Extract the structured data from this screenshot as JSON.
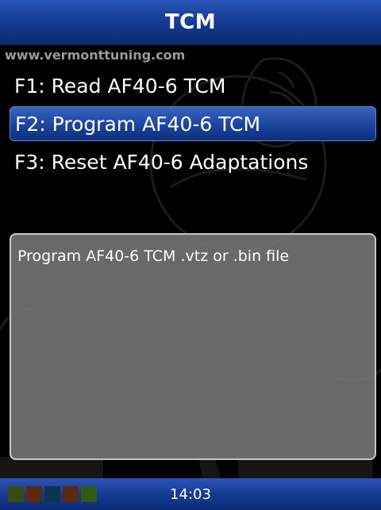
{
  "header": {
    "title": "TCM"
  },
  "watermark": {
    "url": "www.vermonttuning.com"
  },
  "menu": {
    "items": [
      {
        "label": "F1: Read AF40-6 TCM",
        "selected": false
      },
      {
        "label": "F2: Program AF40-6 TCM",
        "selected": true
      },
      {
        "label": "F3: Reset AF40-6 Adaptations",
        "selected": false
      }
    ]
  },
  "description": {
    "text": "Program AF40-6 TCM .vtz or .bin file"
  },
  "status_bar": {
    "time": "14:03",
    "indicators": [
      {
        "name": "status-indicator-1",
        "color": "#3a4a12"
      },
      {
        "name": "status-indicator-2",
        "color": "#5a2a10"
      },
      {
        "name": "status-indicator-3",
        "color": "#0e3550"
      },
      {
        "name": "status-indicator-4",
        "color": "#5a2a10"
      },
      {
        "name": "status-indicator-5",
        "color": "#2f5a18"
      }
    ]
  },
  "colors": {
    "title_bar": "#173d95",
    "selection": "#1e47a0",
    "description_bg": "#787878",
    "background": "#000000"
  }
}
